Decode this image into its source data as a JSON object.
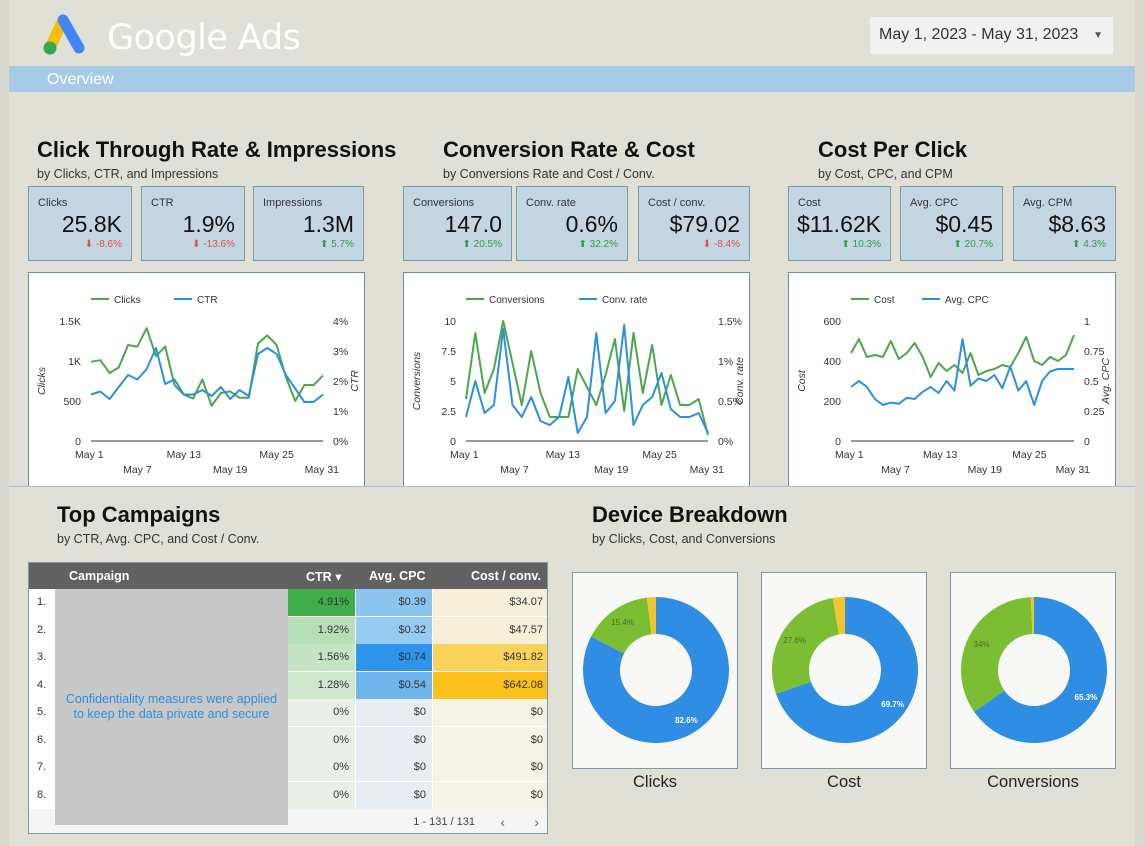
{
  "header": {
    "brand": "Google Ads",
    "date_range": "May 1, 2023 - May 31, 2023",
    "overview_label": "Overview"
  },
  "colors": {
    "green_series": "#4ca64c",
    "blue_series": "#2d8fe0",
    "kpi_bg": "#c4d6e2",
    "donut_blue": "#2f8de4",
    "donut_green": "#7bbd33",
    "donut_yellow": "#f4c430"
  },
  "sections": {
    "ctr": {
      "title": "Click Through Rate & Impressions",
      "subtitle": "by Clicks, CTR, and Impressions"
    },
    "conv": {
      "title": "Conversion Rate & Cost",
      "subtitle": "by Conversions Rate and Cost / Conv."
    },
    "cpc": {
      "title": "Cost Per Click",
      "subtitle": "by Cost, CPC, and CPM"
    },
    "campaigns": {
      "title": "Top Campaigns",
      "subtitle": "by CTR, Avg. CPC, and Cost / Conv."
    },
    "devices": {
      "title": "Device Breakdown",
      "subtitle": "by Clicks, Cost, and Conversions"
    }
  },
  "kpis": [
    {
      "label": "Clicks",
      "value": "25.8K",
      "delta": "-8.6%",
      "dir": "down"
    },
    {
      "label": "CTR",
      "value": "1.9%",
      "delta": "-13.6%",
      "dir": "down"
    },
    {
      "label": "Impressions",
      "value": "1.3M",
      "delta": "5.7%",
      "dir": "up"
    },
    {
      "label": "Conversions",
      "value": "147.0",
      "delta": "20.5%",
      "dir": "up"
    },
    {
      "label": "Conv. rate",
      "value": "0.6%",
      "delta": "32.2%",
      "dir": "up"
    },
    {
      "label": "Cost / conv.",
      "value": "$79.02",
      "delta": "-8.4%",
      "dir": "down"
    },
    {
      "label": "Cost",
      "value": "$11.62K",
      "delta": "10.3%",
      "dir": "up"
    },
    {
      "label": "Avg. CPC",
      "value": "$0.45",
      "delta": "20.7%",
      "dir": "up"
    },
    {
      "label": "Avg. CPM",
      "value": "$8.63",
      "delta": "4.3%",
      "dir": "up"
    }
  ],
  "chart_data": [
    {
      "type": "line",
      "x_tick_labels": [
        "May 1",
        "May 7",
        "May 13",
        "May 19",
        "May 25",
        "May 31"
      ],
      "x_tick_days": [
        1,
        7,
        13,
        19,
        25,
        31
      ],
      "left_axis": {
        "label": "Clicks",
        "ticks": [
          "0",
          "500",
          "1K",
          "1.5K"
        ],
        "range": [
          0,
          1500
        ]
      },
      "right_axis": {
        "label": "CTR",
        "ticks": [
          "0%",
          "1%",
          "2%",
          "3%",
          "4%"
        ],
        "range": [
          0,
          4
        ]
      },
      "series": [
        {
          "name": "Clicks",
          "axis": "left",
          "color": "#4ca64c",
          "values": [
            990,
            1010,
            850,
            920,
            1200,
            1180,
            1410,
            1060,
            1180,
            700,
            580,
            530,
            770,
            440,
            600,
            620,
            540,
            540,
            1220,
            1320,
            1200,
            800,
            500,
            700,
            700,
            820
          ]
        },
        {
          "name": "CTR",
          "axis": "right",
          "color": "#2d8fe0",
          "values": [
            1.55,
            1.65,
            1.4,
            1.8,
            2.2,
            2.05,
            2.4,
            3.1,
            1.9,
            2.05,
            1.55,
            1.55,
            1.7,
            1.5,
            1.8,
            1.4,
            1.7,
            1.5,
            2.9,
            3.1,
            2.9,
            2.2,
            1.75,
            1.3,
            1.3,
            1.55
          ]
        }
      ]
    },
    {
      "type": "line",
      "x_tick_labels": [
        "May 1",
        "May 7",
        "May 13",
        "May 19",
        "May 25",
        "May 31"
      ],
      "x_tick_days": [
        1,
        7,
        13,
        19,
        25,
        31
      ],
      "left_axis": {
        "label": "Conversions",
        "ticks": [
          "0",
          "2.5",
          "5",
          "7.5",
          "10"
        ],
        "range": [
          0,
          10
        ]
      },
      "right_axis": {
        "label": "Conv. rate",
        "ticks": [
          "0%",
          "0.5%",
          "1%",
          "1.5%"
        ],
        "range": [
          0,
          1.5
        ]
      },
      "series": [
        {
          "name": "Conversions",
          "axis": "left",
          "color": "#4ca64c",
          "values": [
            3.5,
            9,
            4,
            6,
            10,
            6.5,
            3,
            7.5,
            4,
            2,
            2,
            2,
            6,
            4.5,
            3,
            5.5,
            8.5,
            2.5,
            9,
            4,
            8,
            3,
            5.5,
            3,
            3,
            3.5,
            0.5
          ]
        },
        {
          "name": "Conv. rate",
          "axis": "right",
          "color": "#2d8fe0",
          "values": [
            0.3,
            0.75,
            0.35,
            0.45,
            1.4,
            0.45,
            0.3,
            0.55,
            0.25,
            0.2,
            0.3,
            0.8,
            0.1,
            0.3,
            1.35,
            0.35,
            0.5,
            1.45,
            0.2,
            0.45,
            0.55,
            0.85,
            0.4,
            0.3,
            0.3,
            0.35,
            0.1
          ]
        }
      ]
    },
    {
      "type": "line",
      "x_tick_labels": [
        "May 1",
        "May 7",
        "May 13",
        "May 19",
        "May 25",
        "May 31"
      ],
      "x_tick_days": [
        1,
        7,
        13,
        19,
        25,
        31
      ],
      "left_axis": {
        "label": "Cost",
        "ticks": [
          "0",
          "200",
          "400",
          "600"
        ],
        "range": [
          0,
          600
        ]
      },
      "right_axis": {
        "label": "Avg. CPC",
        "ticks": [
          "0",
          "0.25",
          "0.5",
          "0.75",
          "1"
        ],
        "range": [
          0,
          1
        ]
      },
      "series": [
        {
          "name": "Cost",
          "axis": "left",
          "color": "#4ca64c",
          "values": [
            440,
            510,
            420,
            430,
            420,
            500,
            410,
            440,
            490,
            420,
            320,
            390,
            350,
            380,
            340,
            440,
            330,
            350,
            360,
            380,
            370,
            440,
            520,
            400,
            380,
            420,
            400,
            430,
            530
          ]
        },
        {
          "name": "Avg. CPC",
          "axis": "right",
          "color": "#2d8fe0",
          "values": [
            0.45,
            0.5,
            0.45,
            0.35,
            0.3,
            0.32,
            0.31,
            0.36,
            0.35,
            0.41,
            0.45,
            0.4,
            0.5,
            0.42,
            0.85,
            0.46,
            0.52,
            0.5,
            0.55,
            0.44,
            0.62,
            0.42,
            0.5,
            0.3,
            0.5,
            0.58,
            0.6,
            0.6,
            0.6
          ]
        }
      ]
    },
    {
      "type": "pie",
      "title": "Clicks",
      "slices": [
        {
          "value": 82.6,
          "label": "82.6%",
          "color": "#2f8de4"
        },
        {
          "value": 15.4,
          "label": "15.4%",
          "color": "#7bbd33"
        },
        {
          "value": 2.0,
          "label": "",
          "color": "#f4c430"
        }
      ]
    },
    {
      "type": "pie",
      "title": "Cost",
      "slices": [
        {
          "value": 69.7,
          "label": "69.7%",
          "color": "#2f8de4"
        },
        {
          "value": 27.6,
          "label": "27.6%",
          "color": "#7bbd33"
        },
        {
          "value": 2.7,
          "label": "",
          "color": "#f4c430"
        }
      ]
    },
    {
      "type": "pie",
      "title": "Conversions",
      "slices": [
        {
          "value": 65.3,
          "label": "65.3%",
          "color": "#2f8de4"
        },
        {
          "value": 34.0,
          "label": "34%",
          "color": "#7bbd33"
        },
        {
          "value": 0.7,
          "label": "",
          "color": "#f4c430"
        }
      ]
    }
  ],
  "table": {
    "headers": [
      "Campaign",
      "CTR",
      "Avg. CPC",
      "Cost / conv."
    ],
    "sort_indicator": "▾",
    "confidential_note": "Confidentiality measures were applied to keep the data private and secure",
    "rows": [
      {
        "n": "1.",
        "ctr": "4.91%",
        "cpc": "$0.39",
        "cost": "$34.07",
        "ctr_bg": "#3fae49",
        "cpc_bg": "#8cc5f0",
        "cost_bg": "#f7efd8"
      },
      {
        "n": "2.",
        "ctr": "1.92%",
        "cpc": "$0.32",
        "cost": "$47.57",
        "ctr_bg": "#b7dfb6",
        "cpc_bg": "#96cbf3",
        "cost_bg": "#f7efd8"
      },
      {
        "n": "3.",
        "ctr": "1.56%",
        "cpc": "$0.74",
        "cost": "$491.82",
        "ctr_bg": "#c4e4c3",
        "cpc_bg": "#2f94ec",
        "cost_bg": "#fcd35a"
      },
      {
        "n": "4.",
        "ctr": "1.28%",
        "cpc": "$0.54",
        "cost": "$642.08",
        "ctr_bg": "#cde8cb",
        "cpc_bg": "#6fb6ee",
        "cost_bg": "#fcc11c"
      },
      {
        "n": "5.",
        "ctr": "0%",
        "cpc": "$0",
        "cost": "$0",
        "ctr_bg": "#eaf0e8",
        "cpc_bg": "#e8eef3",
        "cost_bg": "#f5f2e8"
      },
      {
        "n": "6.",
        "ctr": "0%",
        "cpc": "$0",
        "cost": "$0",
        "ctr_bg": "#eaf0e8",
        "cpc_bg": "#e8eef3",
        "cost_bg": "#f5f2e8"
      },
      {
        "n": "7.",
        "ctr": "0%",
        "cpc": "$0",
        "cost": "$0",
        "ctr_bg": "#eaf0e8",
        "cpc_bg": "#e8eef3",
        "cost_bg": "#f5f2e8"
      },
      {
        "n": "8.",
        "ctr": "0%",
        "cpc": "$0",
        "cost": "$0",
        "ctr_bg": "#eaf0e8",
        "cpc_bg": "#e8eef3",
        "cost_bg": "#f5f2e8"
      }
    ],
    "pager": {
      "range": "1 - 131 / 131",
      "prev": "‹",
      "next": "›"
    }
  }
}
